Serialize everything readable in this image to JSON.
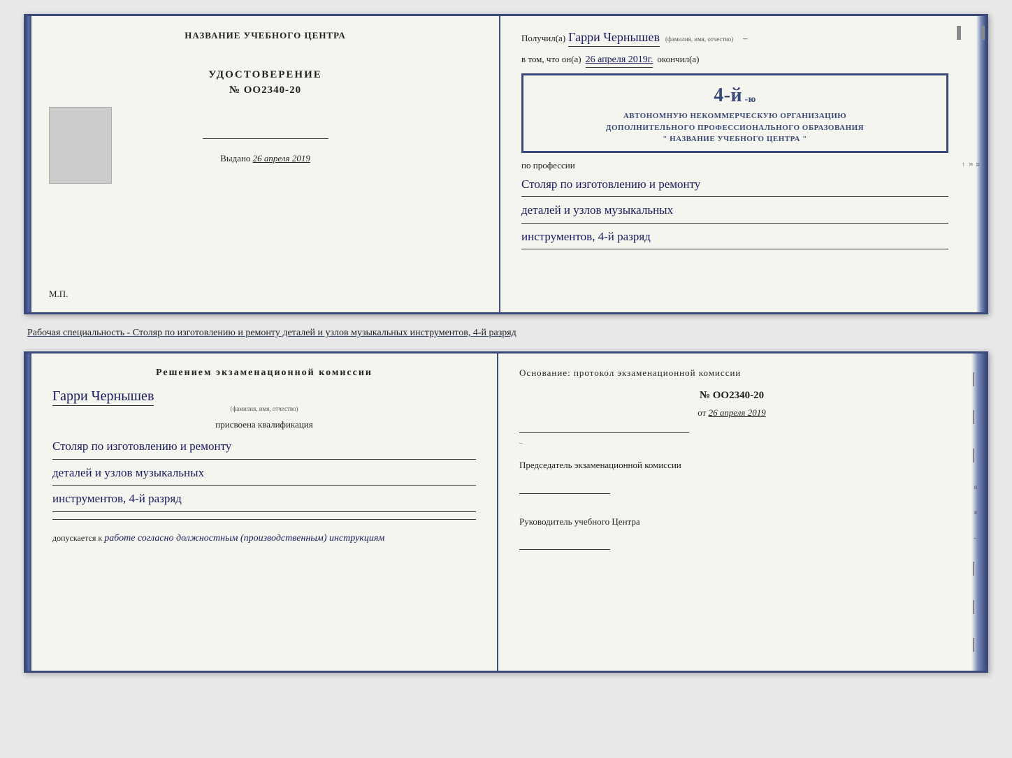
{
  "top_spread": {
    "left": {
      "title": "НАЗВАНИЕ УЧЕБНОГО ЦЕНТРА",
      "cert_type": "УДОСТОВЕРЕНИЕ",
      "cert_number": "№ OO2340-20",
      "vydano_label": "Выдано",
      "vydano_date": "26 апреля 2019",
      "mp_label": "М.П."
    },
    "right": {
      "poluchil_prefix": "Получил(а)",
      "recipient_name": "Гарри Чернышев",
      "fio_label": "(фамилия, имя, отчество)",
      "vtom_prefix": "в том, что он(а)",
      "date_label": "26 апреля 2019г.",
      "okonchil_label": "окончил(а)",
      "stamp_line1": "АВТОНОМНУЮ НЕКОММЕРЧЕСКУЮ ОРГАНИЗАЦИЮ",
      "stamp_line2": "ДОПОЛНИТЕЛЬНОГО ПРОФЕССИОНАЛЬНОГО ОБРАЗОВАНИЯ",
      "stamp_line3": "\" НАЗВАНИЕ УЧЕБНОГО ЦЕНТРА \"",
      "stamp_big": "4-й",
      "po_professii_label": "по профессии",
      "profession_line1": "Столяр по изготовлению и ремонту",
      "profession_line2": "деталей и узлов музыкальных",
      "profession_line3": "инструментов, 4-й разряд"
    }
  },
  "caption": "Рабочая специальность - Столяр по изготовлению и ремонту деталей и узлов музыкальных инструментов, 4-й разряд",
  "bottom_spread": {
    "left": {
      "title": "Решением  экзаменационной  комиссии",
      "name": "Гарри Чернышев",
      "fio_label": "(фамилия, имя, отчество)",
      "prisvoena_label": "присвоена квалификация",
      "profession_line1": "Столяр по изготовлению и ремонту",
      "profession_line2": "деталей и узлов музыкальных",
      "profession_line3": "инструментов, 4-й разряд",
      "dopusk_prefix": "допускается к",
      "dopusk_text": "работе согласно должностным (производственным) инструкциям"
    },
    "right": {
      "osnovanie_label": "Основание:  протокол  экзаменационной  комиссии",
      "doc_number": "№  OO2340-20",
      "ot_prefix": "от",
      "ot_date": "26 апреля 2019",
      "predsedatel_label": "Председатель экзаменационной комиссии",
      "rukovo_label": "Руководитель учебного Центра"
    }
  },
  "edge_letters": {
    "and": "и",
    "ya": "я",
    "k_arrow": "←"
  }
}
